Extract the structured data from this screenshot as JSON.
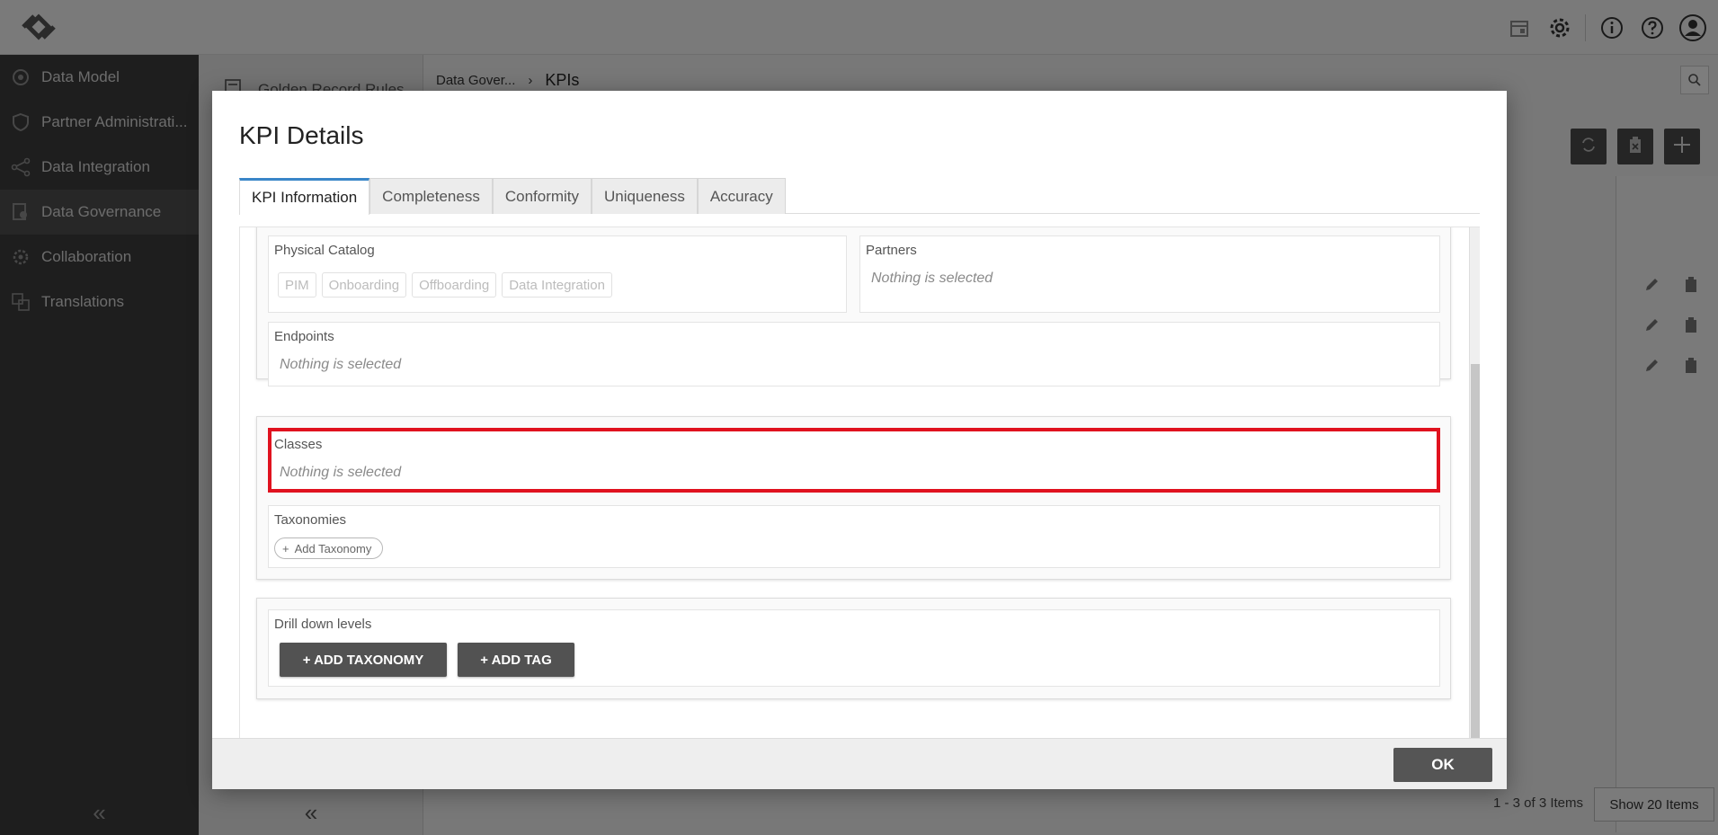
{
  "sidebar": {
    "items": [
      {
        "label": "Data Model",
        "icon": "cubes-icon"
      },
      {
        "label": "Partner Administrati...",
        "icon": "shield-icon"
      },
      {
        "label": "Data Integration",
        "icon": "network-icon"
      },
      {
        "label": "Data Governance",
        "icon": "governance-icon"
      },
      {
        "label": "Collaboration",
        "icon": "gears-icon"
      },
      {
        "label": "Translations",
        "icon": "translate-icon"
      }
    ],
    "collapse_icon": "«"
  },
  "subnav": {
    "item_label": "Golden Record Rules",
    "collapse_icon": "«"
  },
  "breadcrumb": {
    "parent": "Data Gover...",
    "separator": "›",
    "current": "KPIs"
  },
  "pager": {
    "summary": "1 - 3 of 3 Items",
    "page_size_label": "Show 20 Items"
  },
  "modal": {
    "title": "KPI Details",
    "tabs": [
      "KPI Information",
      "Completeness",
      "Conformity",
      "Uniqueness",
      "Accuracy"
    ],
    "active_tab": "KPI Information",
    "physical_catalog": {
      "label": "Physical Catalog",
      "chips": [
        "PIM",
        "Onboarding",
        "Offboarding",
        "Data Integration"
      ]
    },
    "partners": {
      "label": "Partners",
      "value": "Nothing is selected"
    },
    "endpoints": {
      "label": "Endpoints",
      "value": "Nothing is selected"
    },
    "classes": {
      "label": "Classes",
      "value": "Nothing is selected"
    },
    "taxonomies": {
      "label": "Taxonomies",
      "add_label": "Add Taxonomy",
      "add_icon": "+"
    },
    "drill_down": {
      "label": "Drill down levels",
      "add_taxonomy_label": "+ ADD TAXONOMY",
      "add_tag_label": "+ ADD TAG"
    },
    "ok_label": "OK"
  },
  "colors": {
    "accent": "#3a86c8",
    "highlight": "#e0121f",
    "sidebar_bg": "#3d3d3d",
    "button_dark": "#525252"
  }
}
